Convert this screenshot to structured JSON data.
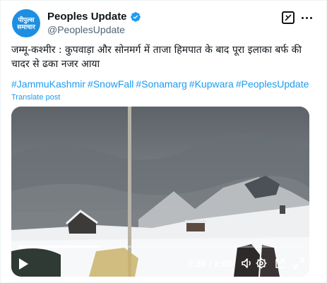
{
  "author": {
    "display_name": "Peoples Update",
    "handle": "@PeoplesUpdate",
    "avatar_line1": "पीपुल्स",
    "avatar_line2": "समाचार"
  },
  "icons": {
    "verified": "verified-badge-icon",
    "grok": "grok-icon",
    "more": "more-icon",
    "play": "play-icon",
    "volume": "volume-icon",
    "settings": "settings-icon",
    "pip": "picture-in-picture-icon",
    "fullscreen": "fullscreen-icon"
  },
  "colors": {
    "accent": "#1d9bf0",
    "text": "#0f1419",
    "muted": "#536471"
  },
  "tweet": {
    "text": "जम्मू-कश्मीर : कुपवाड़ा और सोनमर्ग में ताजा हिमपात के बाद पूरा इलाका बर्फ की चादर से ढका नजर आया",
    "hashtags": [
      "#JammuKashmir",
      "#SnowFall",
      "#Sonamarg",
      "#Kupwara",
      "#PeoplesUpdate"
    ],
    "translate_label": "Translate post"
  },
  "video": {
    "time_display": "0:36 / 2:05",
    "progress_fraction": 0.29
  }
}
